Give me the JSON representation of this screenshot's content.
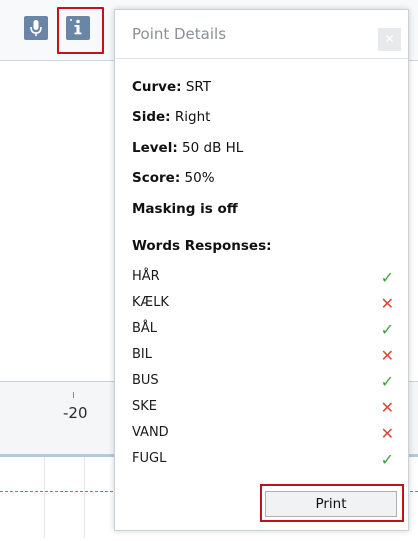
{
  "toolbar": {
    "mic_icon": "microphone-icon",
    "info_icon": "info-icon"
  },
  "chart": {
    "tick_label": "-20"
  },
  "popup": {
    "title": "Point Details",
    "close_icon": "close-icon",
    "curve_label": "Curve:",
    "curve_value": "SRT",
    "side_label": "Side:",
    "side_value": "Right",
    "level_label": "Level:",
    "level_value": "50 dB HL",
    "score_label": "Score:",
    "score_value": "50%",
    "masking": "Masking is off",
    "words_heading": "Words Responses:",
    "words": [
      {
        "word": "HÅR",
        "result": "correct"
      },
      {
        "word": "KÆLK",
        "result": "incorrect"
      },
      {
        "word": "BÅL",
        "result": "correct"
      },
      {
        "word": "BIL",
        "result": "incorrect"
      },
      {
        "word": "BUS",
        "result": "correct"
      },
      {
        "word": "SKE",
        "result": "incorrect"
      },
      {
        "word": "VAND",
        "result": "incorrect"
      },
      {
        "word": "FUGL",
        "result": "correct"
      }
    ],
    "print_label": "Print"
  },
  "colors": {
    "highlight": "#c2131b",
    "correct": "#3aa53a",
    "incorrect": "#e0463c"
  }
}
